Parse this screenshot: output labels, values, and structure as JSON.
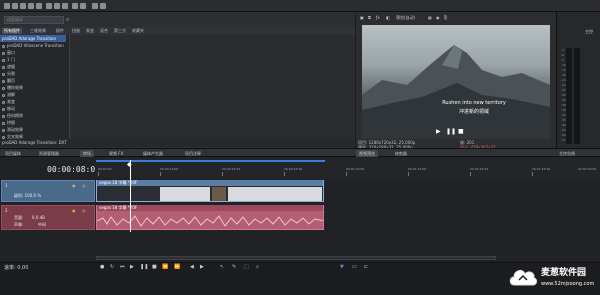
{
  "explorer": {
    "search_placeholder": "搜索媒体",
    "tabs": [
      "所有插件",
      "三维效果",
      "插件",
      "扭曲",
      "渐变",
      "混合",
      "第三方",
      "收藏夹"
    ],
    "tree_items": [
      "proDAD Adorage Transition",
      "proDAD Vitascene Transition",
      "窗口",
      "1 门",
      "遮幅",
      "分割",
      "翻页",
      "爆炸效果",
      "溶解",
      "渐变",
      "移动",
      "径向擦除",
      "拼图",
      "滑动效果",
      "交叉效果"
    ],
    "status": "proDAD Adorage Transition: DXT"
  },
  "preview": {
    "toolbar_label": "预览(自动)",
    "subtitle_en": "Rushen into new territory",
    "subtitle_cn": "冲进新的领域",
    "info": {
      "project_label": "项目: 1280x720x32, 25.000p",
      "preview_label": "预览: 320x180x32, 25.000p",
      "frame_label": "帧: 201",
      "display_label": "显示: 476x267x32"
    }
  },
  "master": {
    "label": "主控",
    "ticks": [
      "-3",
      "-6",
      "-9",
      "-12",
      "-15",
      "-18",
      "-21",
      "-24",
      "-27",
      "-30",
      "-33",
      "-36",
      "-39",
      "-42",
      "-45",
      "-48",
      "-51",
      "-54",
      "-57"
    ]
  },
  "panel_tabs": [
    "项目媒体",
    "资源管理器",
    "转场",
    "视频 FX",
    "媒体产生器",
    "项目注释",
    "视频预览",
    "修剪器",
    "主控总线"
  ],
  "timeline": {
    "timecode": "00:00:08:01",
    "ruler_labels": [
      "00:00:00",
      "00:00:15:00",
      "00:00:29:29",
      "00:00:44:29",
      "00:01:00:00",
      "00:01:15:00",
      "00:01:29:29",
      "00:01:44:29",
      "00:02:00:00"
    ],
    "video_track": {
      "level_label": "级别: 100.0 %"
    },
    "audio_track": {
      "volume_label": "音量:",
      "volume_value": "0.0 dB",
      "pan_label": "声像:",
      "pan_value": "中间"
    },
    "video_clip_title": "vegas 18 字幕 *20F",
    "audio_clip_title": "vegas 18 字幕 *20F",
    "rate_label": "速率: 0.00"
  },
  "watermark": {
    "brand": "麦葱软件园",
    "url": "www.52mjsoong.com"
  }
}
